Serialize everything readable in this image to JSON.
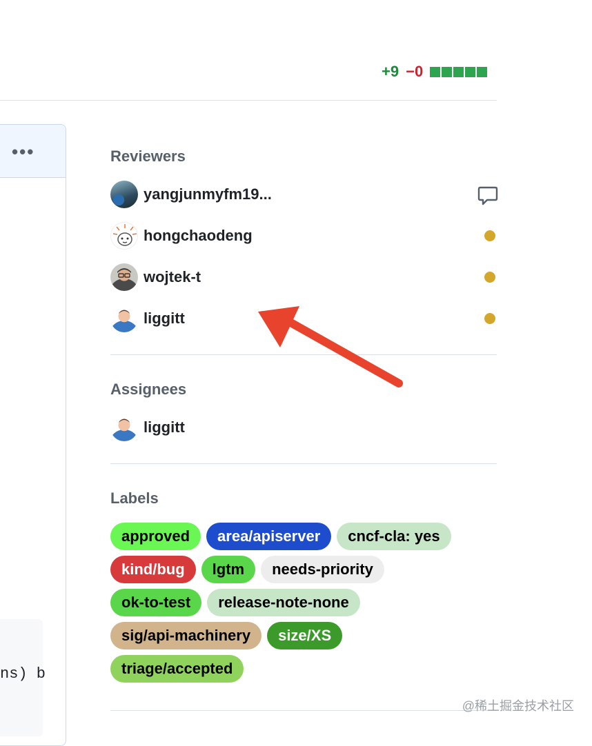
{
  "diffstat": {
    "additions": "+9",
    "deletions": "−0",
    "blocks": [
      "added",
      "added",
      "added",
      "added",
      "added"
    ],
    "color_add": "#1f883d",
    "color_del": "#cf222e"
  },
  "card": {
    "menu_label": "•••",
    "code_snippet": "ns) b"
  },
  "reviewers": {
    "title": "Reviewers",
    "items": [
      {
        "name": "yangjunmyfm19...",
        "status": "comment-icon"
      },
      {
        "name": "hongchaodeng",
        "status": "pending"
      },
      {
        "name": "wojtek-t",
        "status": "pending"
      },
      {
        "name": "liggitt",
        "status": "pending"
      }
    ]
  },
  "assignees": {
    "title": "Assignees",
    "items": [
      {
        "name": "liggitt"
      }
    ]
  },
  "labels": {
    "title": "Labels",
    "rows": [
      [
        {
          "name": "approved",
          "bg": "#6af754",
          "fg": "#000000"
        },
        {
          "name": "area/apiserver",
          "bg": "#1d4dcd",
          "fg": "#ffffff"
        },
        {
          "name": "cncf-cla: yes",
          "bg": "#c7e6c8",
          "fg": "#000000"
        }
      ],
      [
        {
          "name": "kind/bug",
          "bg": "#d73a3a",
          "fg": "#ffffff"
        },
        {
          "name": "lgtm",
          "bg": "#5ad64a",
          "fg": "#000000"
        },
        {
          "name": "needs-priority",
          "bg": "#ededed",
          "fg": "#000000"
        }
      ],
      [
        {
          "name": "ok-to-test",
          "bg": "#5ad64a",
          "fg": "#000000"
        },
        {
          "name": "release-note-none",
          "bg": "#c7e6c8",
          "fg": "#000000"
        }
      ],
      [
        {
          "name": "sig/api-machinery",
          "bg": "#d2b48c",
          "fg": "#000000"
        },
        {
          "name": "size/XS",
          "bg": "#3b9a2a",
          "fg": "#ffffff"
        }
      ],
      [
        {
          "name": "triage/accepted",
          "bg": "#8fd35c",
          "fg": "#000000"
        }
      ]
    ]
  },
  "watermark": "@稀土掘金技术社区"
}
